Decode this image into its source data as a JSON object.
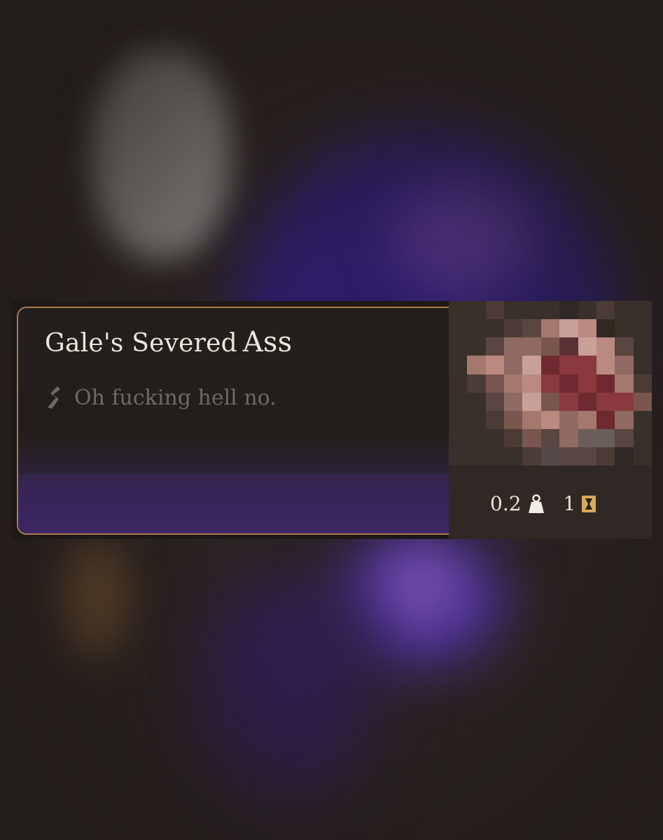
{
  "item": {
    "name_prefix": "Gale's Severed",
    "name_suffix": "Ass",
    "description": "Oh fucking hell no.",
    "weight": "0.2",
    "count": "1"
  },
  "icons": {
    "description": "scroll-swirl-icon",
    "weight": "weight-icon",
    "count": "hourglass-icon",
    "item": "item-thumbnail-pixelated"
  },
  "colors": {
    "border": "#a97c52",
    "title": "#ece6dc",
    "description": "#6f6964",
    "footer": "#3b2660",
    "gold": "#d9a95a"
  }
}
